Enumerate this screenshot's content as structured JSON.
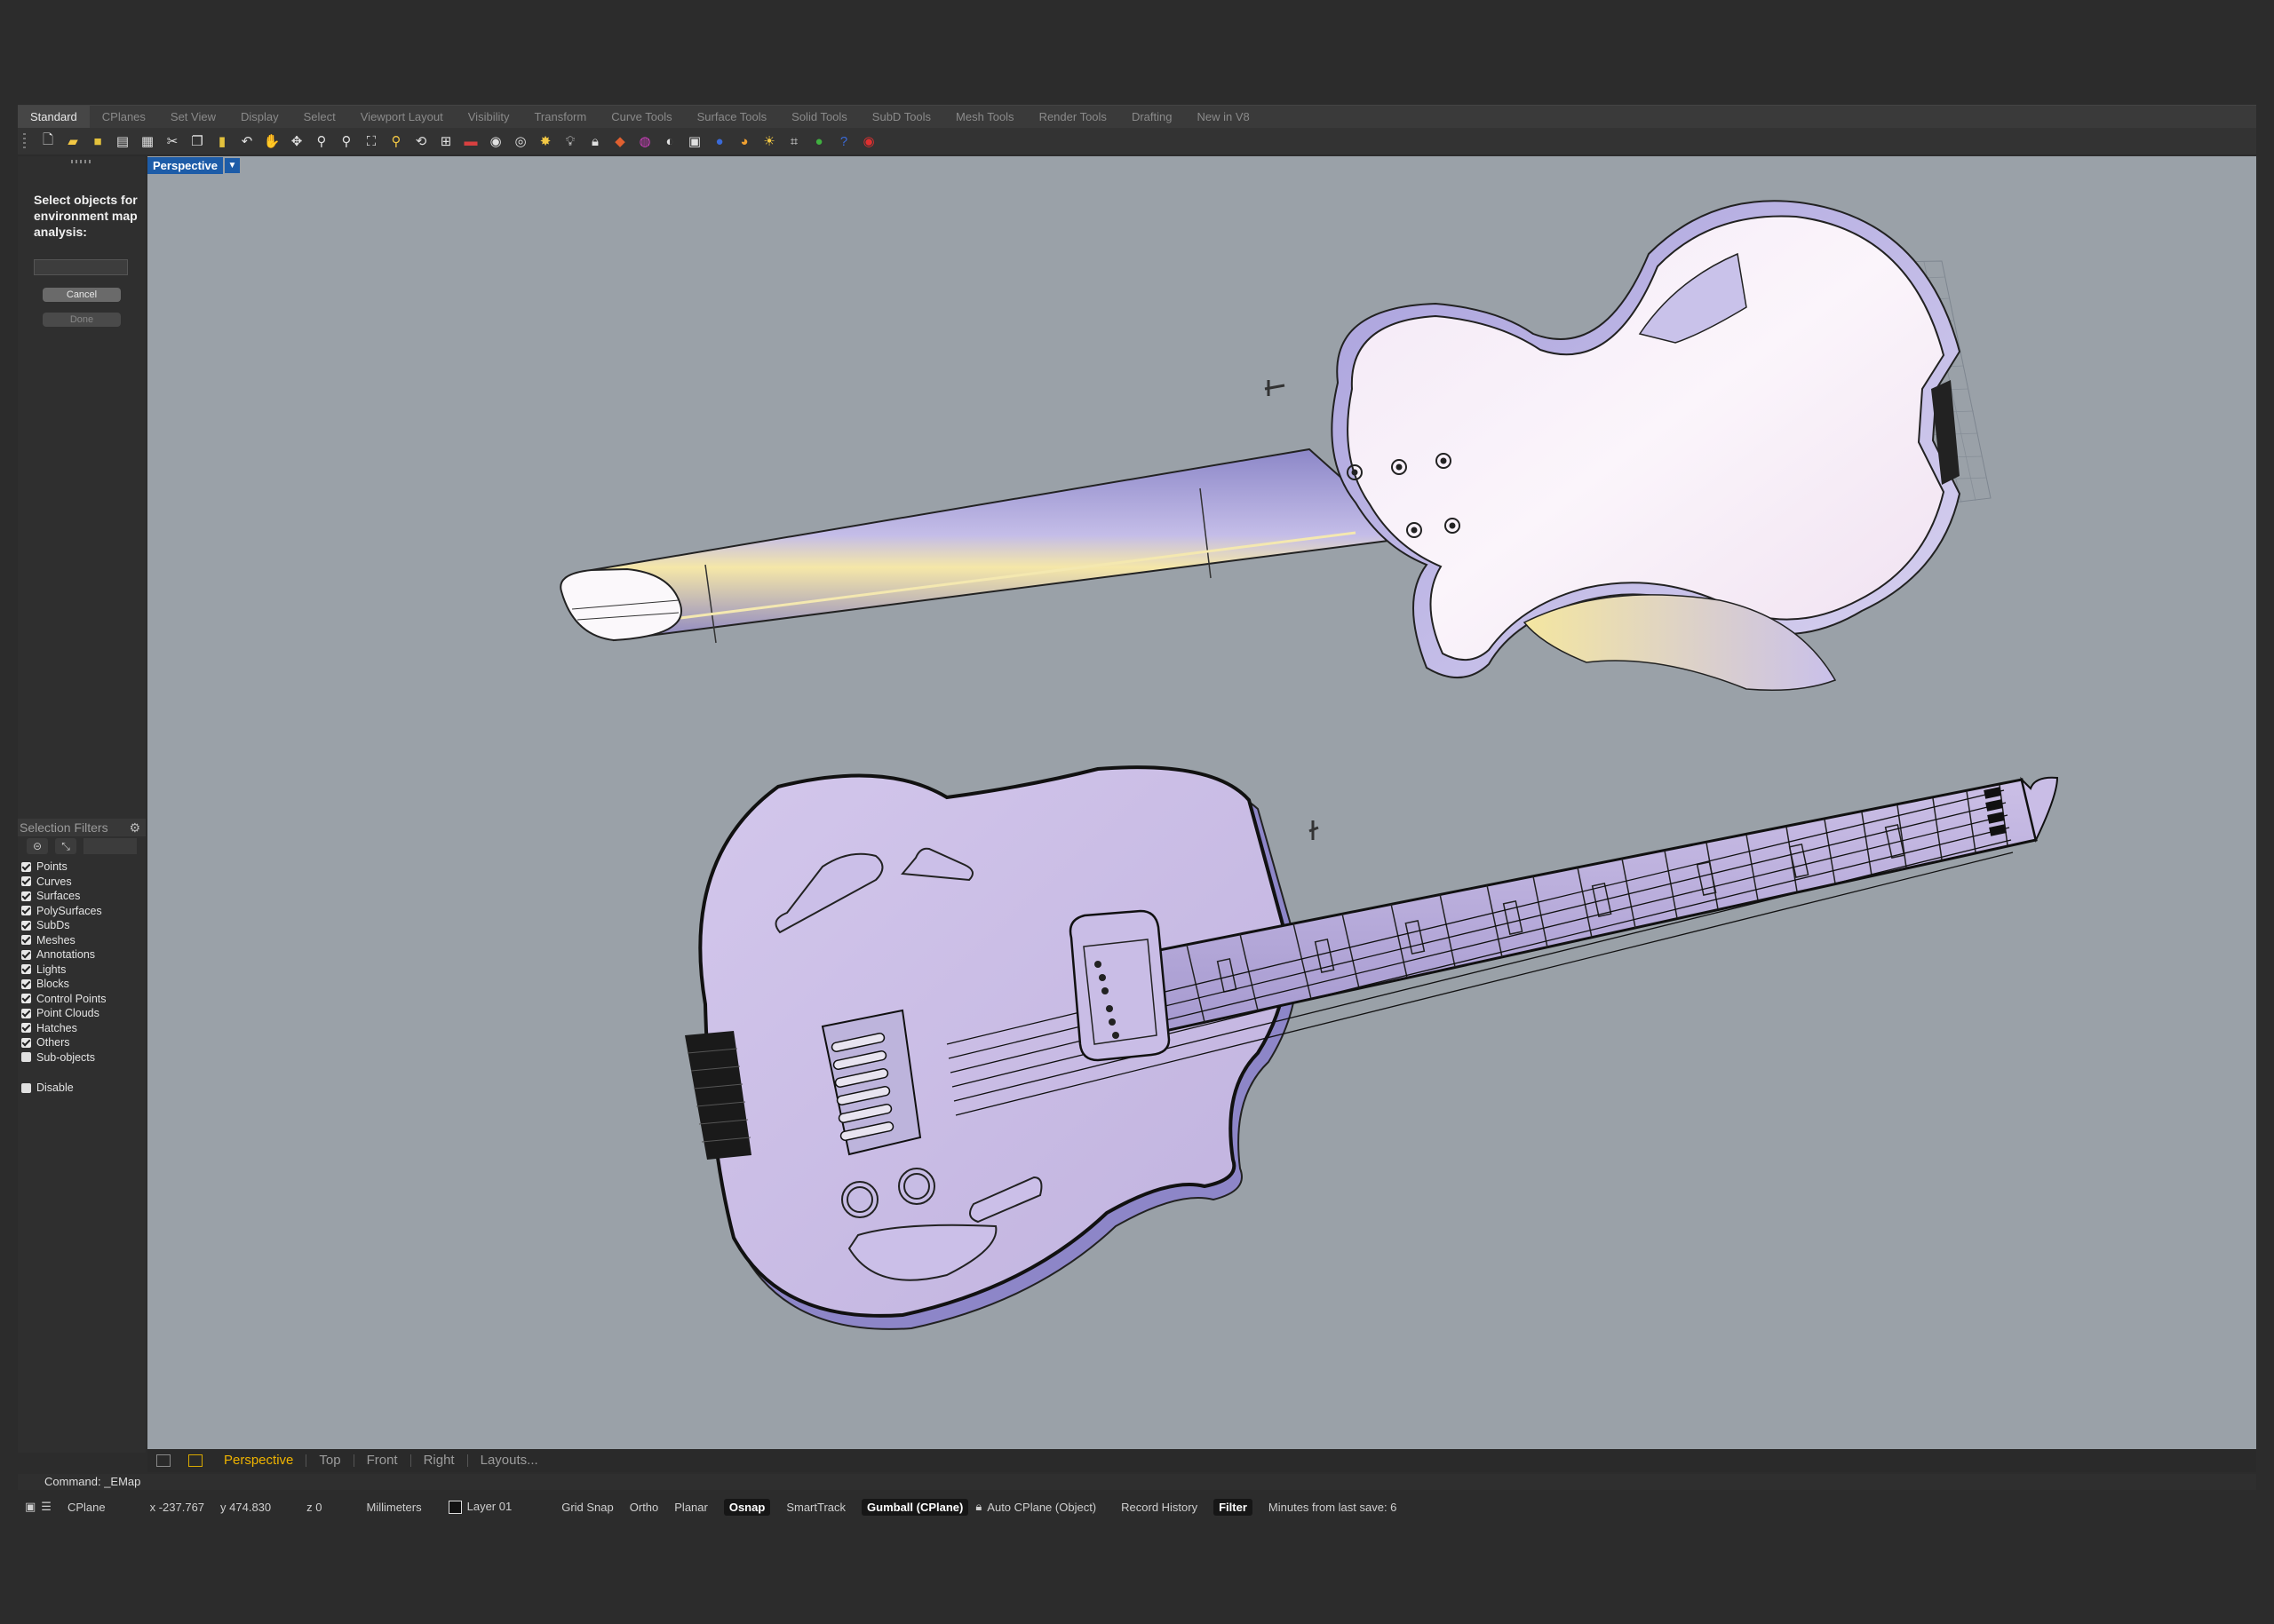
{
  "ribbon_tabs": [
    "Standard",
    "CPlanes",
    "Set View",
    "Display",
    "Select",
    "Viewport Layout",
    "Visibility",
    "Transform",
    "Curve Tools",
    "Surface Tools",
    "Solid Tools",
    "SubD Tools",
    "Mesh Tools",
    "Render Tools",
    "Drafting",
    "New in V8"
  ],
  "toolbar_icons": [
    "new-icon",
    "open-icon",
    "save-icon",
    "print-icon",
    "import-icon",
    "cut-icon",
    "copy-icon",
    "paste-icon",
    "undo-icon",
    "pan-icon",
    "rotate-view-icon",
    "zoom-icon",
    "zoom-window-icon",
    "zoom-extents-icon",
    "zoom-selected-icon",
    "undo-view-icon",
    "four-viewports-icon",
    "car-icon",
    "shaded-icon",
    "wireframe-icon",
    "light-icon",
    "bulb-icon",
    "lock-icon",
    "material-icon",
    "color-wheel-icon",
    "sphere-icon",
    "render-sphere-icon",
    "texture-icon",
    "environment-icon",
    "sun-icon",
    "dimension-icon",
    "globe-icon",
    "help-icon",
    "chat-icon"
  ],
  "command_prompt": {
    "text": "Select objects for environment map analysis:",
    "cancel": "Cancel",
    "done": "Done"
  },
  "selection_filters": {
    "title": "Selection Filters",
    "items": [
      {
        "label": "Points",
        "checked": true
      },
      {
        "label": "Curves",
        "checked": true
      },
      {
        "label": "Surfaces",
        "checked": true
      },
      {
        "label": "PolySurfaces",
        "checked": true
      },
      {
        "label": "SubDs",
        "checked": true
      },
      {
        "label": "Meshes",
        "checked": true
      },
      {
        "label": "Annotations",
        "checked": true
      },
      {
        "label": "Lights",
        "checked": true
      },
      {
        "label": "Blocks",
        "checked": true
      },
      {
        "label": "Control Points",
        "checked": true
      },
      {
        "label": "Point Clouds",
        "checked": true
      },
      {
        "label": "Hatches",
        "checked": true
      },
      {
        "label": "Others",
        "checked": true
      },
      {
        "label": "Sub-objects",
        "checked": false
      }
    ],
    "disable": "Disable"
  },
  "viewport": {
    "label": "Perspective"
  },
  "viewport_tabs": [
    "Perspective",
    "Top",
    "Front",
    "Right",
    "Layouts..."
  ],
  "command_line": "Command: _EMap",
  "status": {
    "cplane": "CPlane",
    "x": "x -237.767",
    "y": "y 474.830",
    "z": "z 0",
    "units": "Millimeters",
    "layer": "Layer 01",
    "grid_snap": "Grid Snap",
    "ortho": "Ortho",
    "planar": "Planar",
    "osnap": "Osnap",
    "smarttrack": "SmartTrack",
    "gumball": "Gumball (CPlane)",
    "auto_cplane": "Auto CPlane (Object)",
    "record_history": "Record History",
    "filter": "Filter",
    "last_save": "Minutes from last save: 6"
  }
}
